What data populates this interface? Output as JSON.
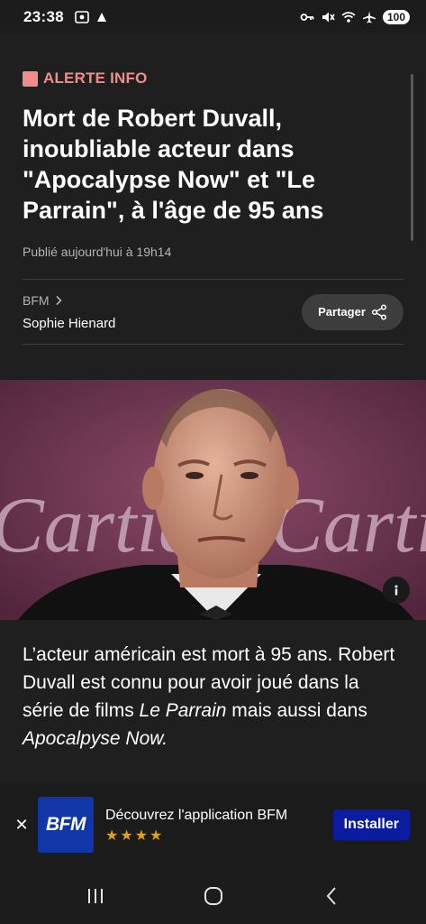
{
  "status_bar": {
    "time": "23:38",
    "battery": "100",
    "icons": [
      "screenshot-icon",
      "vpn-key-icon",
      "mute-icon",
      "wifi-icon",
      "airplane-icon"
    ]
  },
  "article": {
    "alert_label": "ALERTE INFO",
    "headline": "Mort de Robert Duvall, inoubliable acteur dans \"Apocalypse Now\" et \"Le Parrain\", à l'âge de 95 ans",
    "published": "Publié aujourd'hui à 19h14",
    "source": "BFM",
    "author": "Sophie Hienard",
    "share_label": "Partager"
  },
  "photo": {
    "backdrop_text": "Cartier"
  },
  "caption": {
    "part1": "L’acteur américain est mort à 95 ans. Robert Duvall est connu pour avoir joué dans la série de films ",
    "title1": "Le Parrain",
    "part2": " mais aussi dans ",
    "title2": "Apocalpyse Now."
  },
  "app_banner": {
    "close": "✕",
    "logo": "BFM",
    "title": "Découvrez l'application BFM",
    "stars": "★★★★",
    "install_label": "Installer"
  },
  "nav_bar": {
    "items": [
      "recent-apps-icon",
      "home-icon",
      "back-icon"
    ]
  },
  "colors": {
    "alert": "#f28c8c",
    "background": "#1f1f1f",
    "install_button": "#0c1ca0",
    "bfm_logo": "#1036a8",
    "stars": "#e2a019"
  }
}
